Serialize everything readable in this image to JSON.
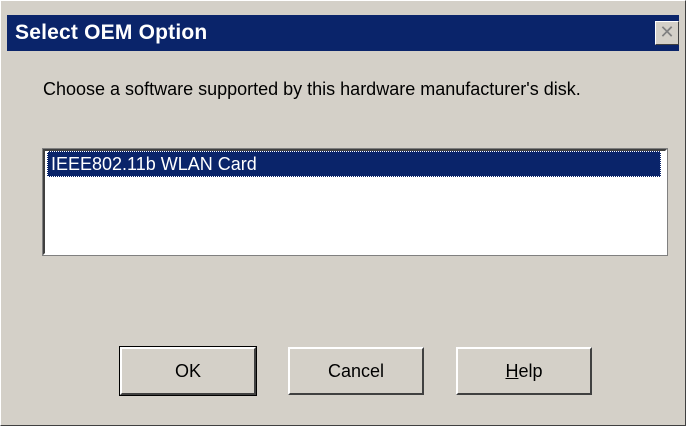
{
  "window": {
    "title": "Select OEM Option",
    "close_glyph": "✕"
  },
  "instruction": "Choose a software supported by this hardware manufacturer's disk.",
  "list": {
    "items": [
      {
        "label": "IEEE802.11b WLAN Card",
        "selected": true
      }
    ]
  },
  "buttons": {
    "ok_label": "OK",
    "cancel_label": "Cancel",
    "help_mnemonic": "H",
    "help_rest": "elp"
  },
  "colors": {
    "titlebar": "#0a246a",
    "face": "#d4d0c8",
    "selection": "#0a246a"
  }
}
